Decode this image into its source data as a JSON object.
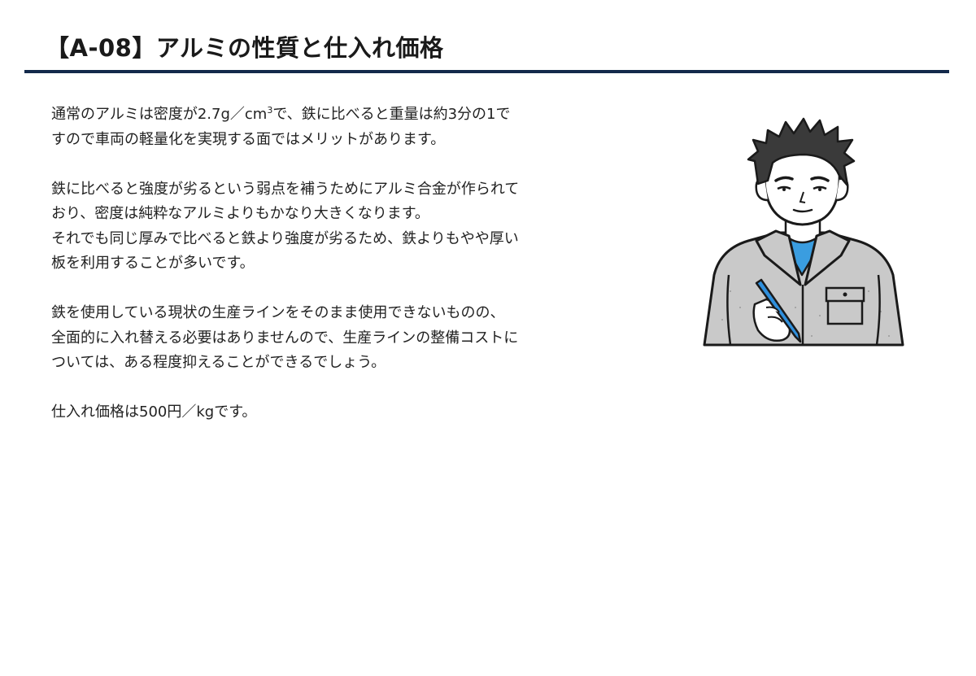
{
  "page": {
    "title": "【A-08】アルミの性質と仕入れ価格"
  },
  "content": {
    "p1": {
      "line1_a": "通常のアルミは密度が2.7g／cm",
      "line1_sup": "3",
      "line1_b": "で、鉄に比べると重量は約3分の1で",
      "line2": "すので車両の軽量化を実現する面ではメリットがあります。"
    },
    "p2": {
      "line1": "鉄に比べると強度が劣るという弱点を補うためにアルミ合金が作られて",
      "line2": "おり、密度は純粋なアルミよりもかなり大きくなります。",
      "line3": "それでも同じ厚みで比べると鉄より強度が劣るため、鉄よりもやや厚い",
      "line4": "板を利用することが多いです。"
    },
    "p3": {
      "line1": "鉄を使用している現状の生産ラインをそのまま使用できないものの、",
      "line2": "全面的に入れ替える必要はありませんので、生産ラインの整備コストに",
      "line3": "ついては、ある程度抑えることができるでしょう。"
    },
    "p4": {
      "line1": "仕入れ価格は500円／kgです。"
    }
  },
  "illustration": {
    "icon": "worker-with-pen-icon"
  },
  "colors": {
    "title_rule": "#13294b",
    "jacket": "#c9c9c9",
    "shirt": "#3a9de0",
    "pen": "#2f8fdc"
  }
}
